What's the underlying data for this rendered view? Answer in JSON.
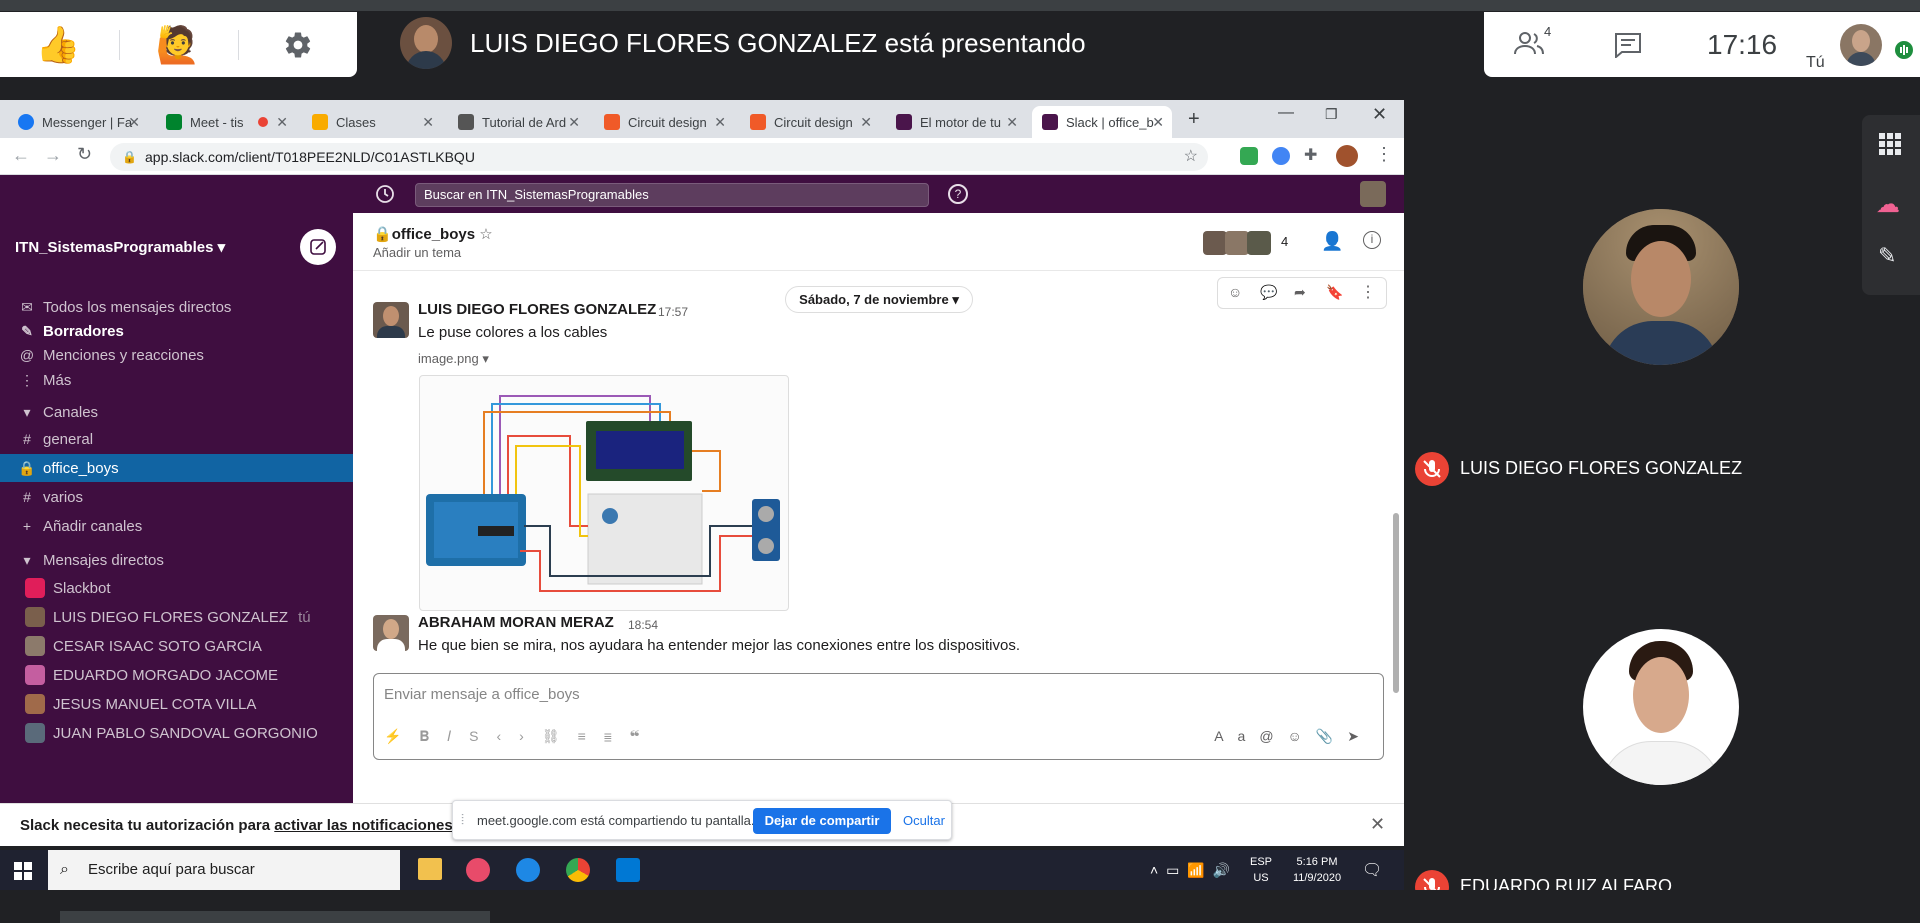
{
  "meet": {
    "presenting_text": "LUIS DIEGO FLORES GONZALEZ está presentando",
    "clock": "17:16",
    "people_count": "4",
    "self_label": "Tú",
    "participants": [
      {
        "name": "LUIS DIEGO FLORES GONZALEZ"
      },
      {
        "name": "EDUARDO RUIZ ALFARO"
      }
    ],
    "share_bar": {
      "text": "meet.google.com está compartiendo tu pantalla.",
      "stop_label": "Dejar de compartir",
      "hide_label": "Ocultar"
    }
  },
  "browser": {
    "tabs": [
      {
        "label": "Messenger | Fa",
        "color": "#1877f2"
      },
      {
        "label": "Meet - tis",
        "color": "#00832d"
      },
      {
        "label": "Clases",
        "color": "#f9ab00"
      },
      {
        "label": "Tutorial de Ard",
        "color": "#555555"
      },
      {
        "label": "Circuit design",
        "color": "#f05a28"
      },
      {
        "label": "Circuit design",
        "color": "#f05a28"
      },
      {
        "label": "El motor de tu",
        "color": "#4a154b"
      },
      {
        "label": "Slack | office_b",
        "color": "#4a154b"
      }
    ],
    "url": "app.slack.com/client/T018PEE2NLD/C01ASTLKBQU"
  },
  "slack": {
    "search_placeholder": "Buscar en ITN_SistemasProgramables",
    "workspace": "ITN_SistemasProgramables",
    "nav": {
      "dms": "Todos los mensajes directos",
      "drafts": "Borradores",
      "mentions": "Menciones y reacciones",
      "more": "Más"
    },
    "channels_header": "Canales",
    "channels": [
      "general",
      "office_boys",
      "varios"
    ],
    "add_channels": "Añadir canales",
    "dm_header": "Mensajes directos",
    "dms": [
      {
        "name": "Slackbot",
        "you": ""
      },
      {
        "name": "LUIS DIEGO FLORES GONZALEZ",
        "you": "tú"
      },
      {
        "name": "CESAR ISAAC SOTO GARCIA",
        "you": ""
      },
      {
        "name": "EDUARDO MORGADO JACOME",
        "you": ""
      },
      {
        "name": "JESUS MANUEL COTA VILLA",
        "you": ""
      },
      {
        "name": "JUAN PABLO SANDOVAL GORGONIO",
        "you": ""
      }
    ],
    "channel": {
      "name": "office_boys",
      "topic": "Añadir un tema",
      "member_count": "4",
      "date_divider": "Sábado, 7 de noviembre"
    },
    "messages": [
      {
        "author": "LUIS DIEGO FLORES GONZALEZ",
        "time": "17:57",
        "text": "Le puse colores a los cables",
        "attachment": "image.png"
      },
      {
        "author": "ABRAHAM MORAN MERAZ",
        "time": "18:54",
        "text": "He que bien se mira, nos ayudara ha entender mejor las conexiones entre los dispositivos."
      }
    ],
    "composer_placeholder": "Enviar mensaje a office_boys",
    "notification": {
      "text": "Slack necesita tu autorización para",
      "link": "activar las notificaciones en"
    }
  },
  "taskbar": {
    "search_placeholder": "Escribe aquí para buscar",
    "lang_top": "ESP",
    "lang_bottom": "US",
    "time": "5:16 PM",
    "date": "11/9/2020"
  }
}
